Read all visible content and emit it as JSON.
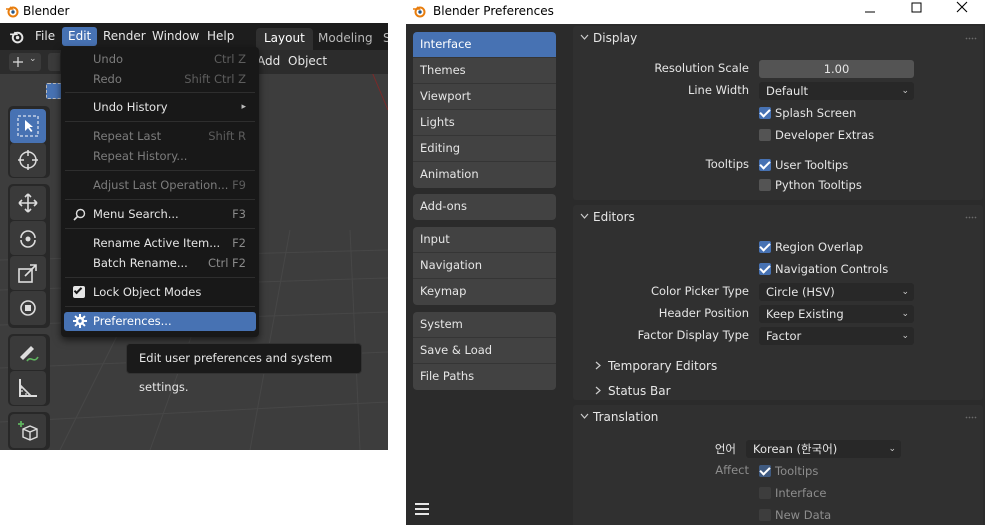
{
  "main_window": {
    "title": "Blender",
    "menu": [
      "File",
      "Edit",
      "Render",
      "Window",
      "Help"
    ],
    "workspace_tabs": [
      "Layout",
      "Modeling",
      "S"
    ],
    "viewport_header": {
      "add": "Add",
      "object": "Object"
    }
  },
  "edit_menu": {
    "items": [
      {
        "label": "Undo",
        "shortcut": "Ctrl Z"
      },
      {
        "label": "Redo",
        "shortcut": "Shift Ctrl Z"
      },
      {
        "label": "Undo History",
        "shortcut": "▸"
      },
      {
        "label": "Repeat Last",
        "shortcut": "Shift R"
      },
      {
        "label": "Repeat History...",
        "shortcut": ""
      },
      {
        "label": "Adjust Last Operation...",
        "shortcut": "F9"
      },
      {
        "label": "Menu Search...",
        "shortcut": "F3"
      },
      {
        "label": "Rename Active Item...",
        "shortcut": "F2"
      },
      {
        "label": "Batch Rename...",
        "shortcut": "Ctrl F2"
      },
      {
        "label": "Lock Object Modes",
        "shortcut": ""
      },
      {
        "label": "Preferences...",
        "shortcut": ""
      }
    ],
    "tooltip": "Edit user preferences and system settings."
  },
  "prefs_window": {
    "title": "Blender Preferences",
    "nav_groups": [
      [
        "Interface",
        "Themes",
        "Viewport",
        "Lights",
        "Editing",
        "Animation"
      ],
      [
        "Add-ons"
      ],
      [
        "Input",
        "Navigation",
        "Keymap"
      ],
      [
        "System",
        "Save & Load",
        "File Paths"
      ]
    ],
    "display": {
      "header": "Display",
      "resolution_scale_label": "Resolution Scale",
      "resolution_scale_value": "1.00",
      "line_width_label": "Line Width",
      "line_width_value": "Default",
      "splash_screen": "Splash Screen",
      "developer_extras": "Developer Extras",
      "tooltips_label": "Tooltips",
      "user_tooltips": "User Tooltips",
      "python_tooltips": "Python Tooltips"
    },
    "editors": {
      "header": "Editors",
      "region_overlap": "Region Overlap",
      "navigation_controls": "Navigation Controls",
      "color_picker_label": "Color Picker Type",
      "color_picker_value": "Circle (HSV)",
      "header_position_label": "Header Position",
      "header_position_value": "Keep Existing",
      "factor_display_label": "Factor Display Type",
      "factor_display_value": "Factor",
      "temporary_editors": "Temporary Editors",
      "status_bar": "Status Bar"
    },
    "translation": {
      "header": "Translation",
      "language_label": "언어",
      "language_value": "Korean (한국어)",
      "affect_label": "Affect",
      "tooltips": "Tooltips",
      "interface": "Interface",
      "new_data": "New Data"
    }
  },
  "colors": {
    "accent": "#4772b3",
    "panel": "#303030",
    "menu_bg": "#181818"
  }
}
